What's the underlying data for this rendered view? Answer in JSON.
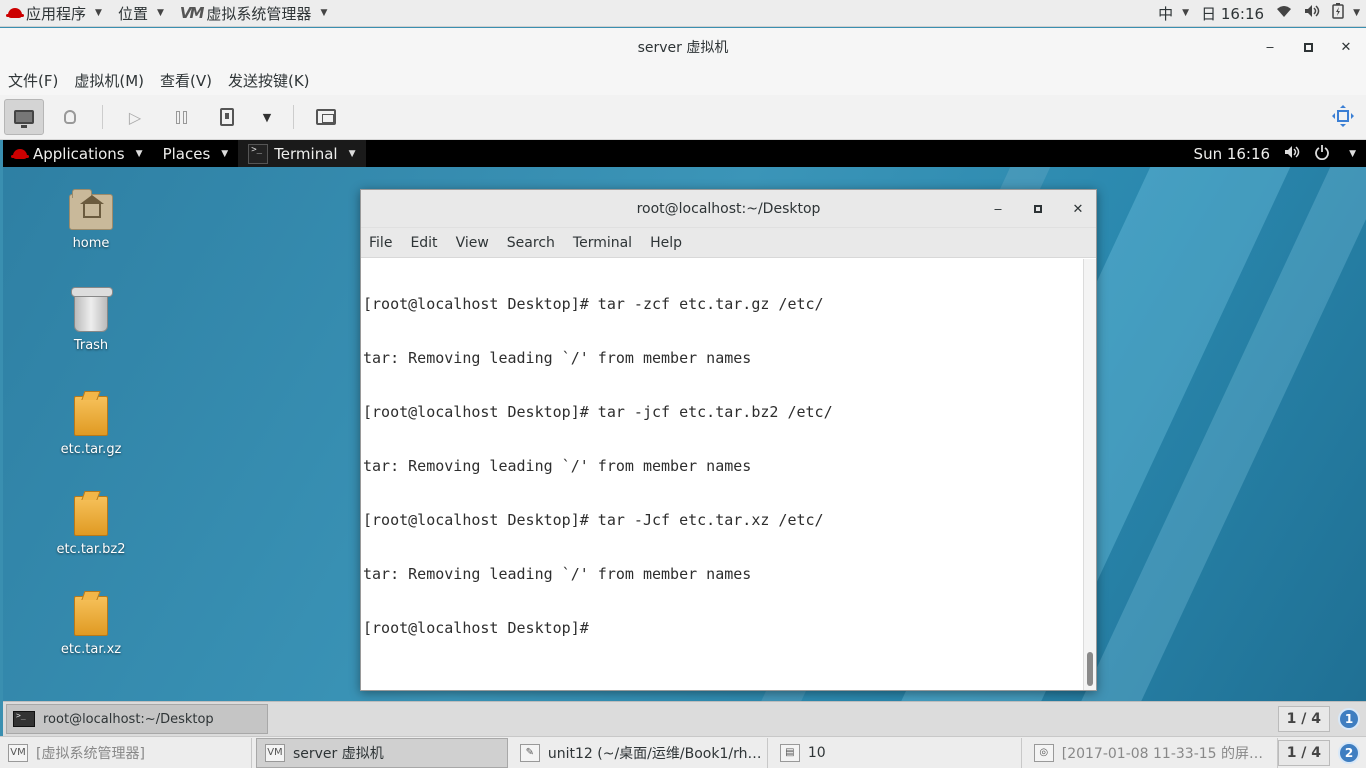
{
  "host_top": {
    "applications": "应用程序",
    "places": "位置",
    "app_logo": "VM",
    "app_name": "虚拟系统管理器",
    "input_method": "中",
    "clock": "日 16:16"
  },
  "vm_window": {
    "title": "server 虚拟机",
    "menu": [
      "文件(F)",
      "虚拟机(M)",
      "查看(V)",
      "发送按键(K)"
    ]
  },
  "guest": {
    "topbar": {
      "applications": "Applications",
      "places": "Places",
      "terminal": "Terminal",
      "clock": "Sun 16:16"
    },
    "desktop_icons": [
      {
        "label": "home"
      },
      {
        "label": "Trash"
      },
      {
        "label": "etc.tar.gz"
      },
      {
        "label": "etc.tar.bz2"
      },
      {
        "label": "etc.tar.xz"
      }
    ],
    "terminal": {
      "title": "root@localhost:~/Desktop",
      "menu": [
        "File",
        "Edit",
        "View",
        "Search",
        "Terminal",
        "Help"
      ],
      "lines": [
        "[root@localhost Desktop]# tar -zcf etc.tar.gz /etc/",
        "tar: Removing leading `/' from member names",
        "[root@localhost Desktop]# tar -jcf etc.tar.bz2 /etc/",
        "tar: Removing leading `/' from member names",
        "[root@localhost Desktop]# tar -Jcf etc.tar.xz /etc/",
        "tar: Removing leading `/' from member names",
        "[root@localhost Desktop]# "
      ]
    },
    "bottombar": {
      "task": "root@localhost:~/Desktop",
      "workspace": "1 / 4",
      "workspace_num": "1"
    }
  },
  "host_taskbar": {
    "tasks": [
      {
        "label": "[虚拟系统管理器]",
        "icon": "VM"
      },
      {
        "label": "server 虚拟机",
        "icon": "VM"
      },
      {
        "label": "unit12 (~/桌面/运维/Book1/rh…",
        "icon": "✎"
      },
      {
        "label": "10",
        "icon": "▤"
      },
      {
        "label": "[2017-01-08 11-33-15 的屏…",
        "icon": "◎"
      }
    ],
    "workspace": "1 / 4",
    "workspace_num": "2"
  }
}
